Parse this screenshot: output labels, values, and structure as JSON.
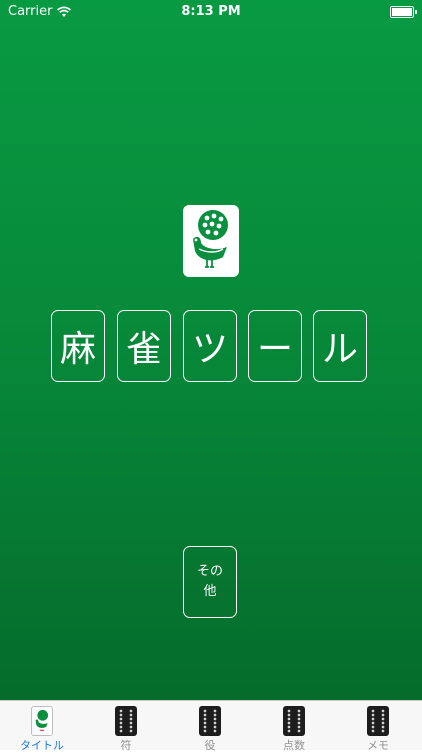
{
  "status_bar": {
    "carrier": "Carrier",
    "time": "8:13 PM",
    "wifi_icon": "wifi-icon",
    "battery_icon": "battery-icon"
  },
  "logo": {
    "icon": "peacock-tile-icon",
    "colors": {
      "tile": "#ffffff",
      "figure": "#0a8f3e"
    }
  },
  "title_tiles": [
    "麻",
    "雀",
    "ツ",
    "ー",
    "ル"
  ],
  "other_button": {
    "line1": "その",
    "line2": "他"
  },
  "tabs": [
    {
      "label": "タイトル",
      "icon": "peacock-tile-icon",
      "active": true
    },
    {
      "label": "符",
      "icon": "tile-icon",
      "active": false
    },
    {
      "label": "役",
      "icon": "tile-icon",
      "active": false
    },
    {
      "label": "点数",
      "icon": "tile-icon",
      "active": false
    },
    {
      "label": "メモ",
      "icon": "tile-icon",
      "active": false
    }
  ],
  "colors": {
    "background_top": "#089a43",
    "background_bottom": "#056c2c",
    "tab_active": "#1a7be0",
    "tab_inactive": "#929292"
  }
}
